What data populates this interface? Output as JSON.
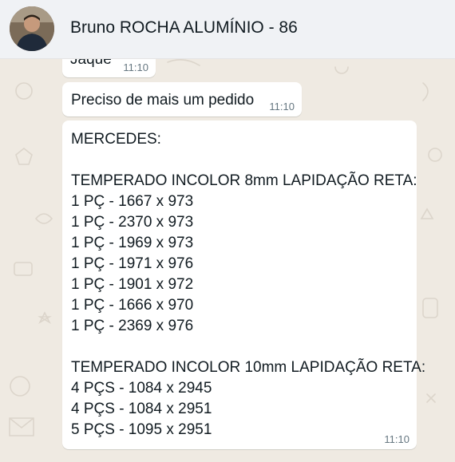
{
  "header": {
    "contact_name": "Bruno ROCHA ALUMÍNIO - 86"
  },
  "messages": [
    {
      "text": "Jaque",
      "time": "11:10"
    },
    {
      "text": "Preciso de mais um pedido",
      "time": "11:10"
    },
    {
      "lines": [
        "MERCEDES:",
        "",
        "TEMPERADO INCOLOR 8mm LAPIDAÇÃO RETA:",
        "1 PÇ - 1667 x 973",
        "1 PÇ - 2370 x 973",
        "1 PÇ - 1969 x 973",
        "1 PÇ - 1971 x 976",
        "1 PÇ - 1901 x 972",
        "1 PÇ - 1666 x 970",
        "1 PÇ - 2369 x 976",
        "",
        "TEMPERADO INCOLOR 10mm LAPIDAÇÃO RETA:",
        "4 PÇS - 1084 x 2945",
        "4 PÇS - 1084 x 2951",
        "5 PÇS - 1095 x 2951"
      ],
      "time": "11:10"
    }
  ],
  "colors": {
    "chat_background": "#efeae2",
    "bubble": "#ffffff",
    "header": "#f0f2f5",
    "timestamp": "#667781"
  },
  "icons": [
    "avatar-photo",
    "chat-wallpaper-doodles"
  ]
}
